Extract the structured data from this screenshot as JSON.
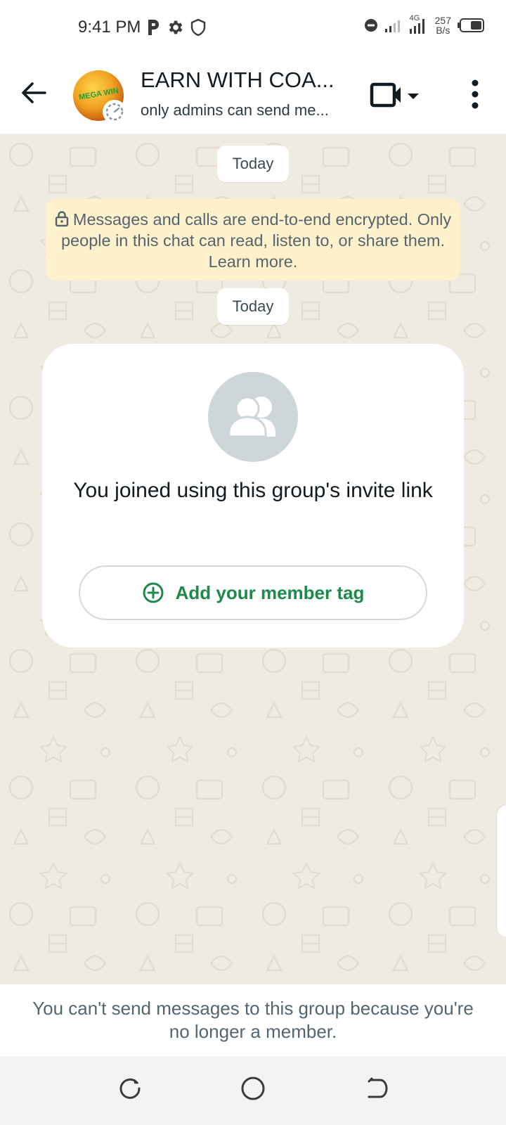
{
  "status_bar": {
    "time": "9:41 PM",
    "left_icons": [
      "p-icon",
      "gear-icon",
      "shield-icon"
    ],
    "right_icons": [
      "dnd-icon",
      "signal-icon",
      "signal-4g-icon",
      "battery-icon"
    ],
    "network_label": "4G",
    "speed_value": "257",
    "speed_unit": "B/s"
  },
  "app_bar": {
    "group_name": "EARN WITH COA...",
    "subtitle": "only admins can send me...",
    "avatar_text": "MEGA WIN",
    "icons": [
      "back-arrow-icon",
      "video-call-icon",
      "dropdown-caret-icon",
      "more-vert-icon"
    ]
  },
  "chat": {
    "date_chip_1": "Today",
    "encryption_notice": "Messages and calls are end-to-end encrypted. Only people in this chat can read, listen to, or share them. Learn more.",
    "date_chip_2": "Today",
    "system_card": {
      "text": "You joined using this group's invite link",
      "button_label": "Add your member tag"
    }
  },
  "footer": {
    "message": "You can't send messages to this group because you're no longer a member."
  },
  "nav_bar": {
    "icons": [
      "recents-icon",
      "home-icon",
      "back-icon"
    ]
  },
  "colors": {
    "accent_green": "#1d8a4c",
    "chat_background": "#f0ebe2",
    "notice_background": "#fff1cc"
  }
}
